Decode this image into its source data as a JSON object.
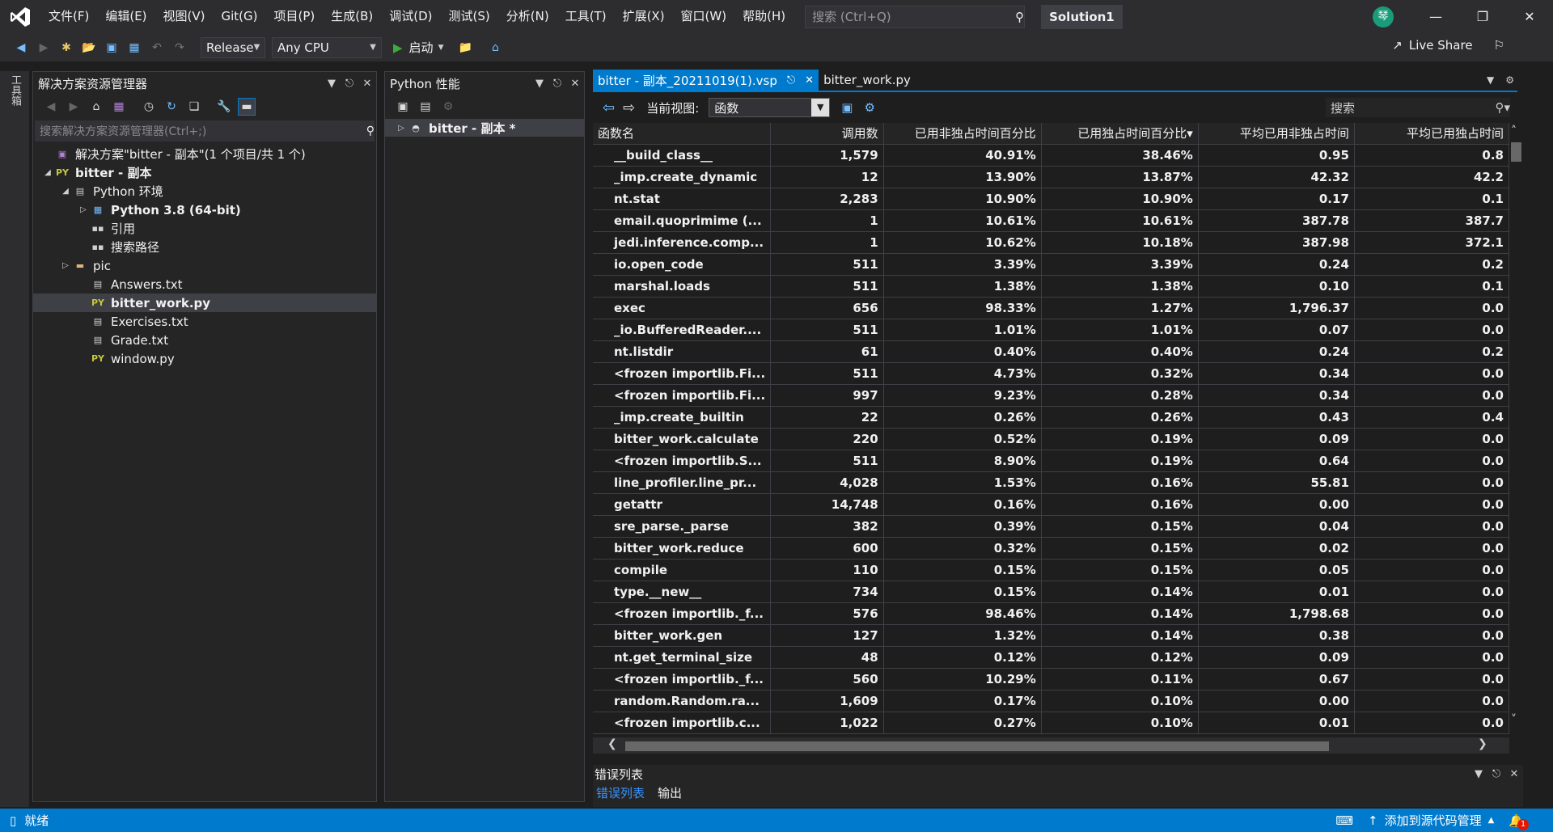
{
  "menubar": {
    "items": [
      "文件(F)",
      "编辑(E)",
      "视图(V)",
      "Git(G)",
      "项目(P)",
      "生成(B)",
      "调试(D)",
      "测试(S)",
      "分析(N)",
      "工具(T)",
      "扩展(X)",
      "窗口(W)",
      "帮助(H)"
    ],
    "search_placeholder": "搜索 (Ctrl+Q)",
    "solution_name": "Solution1",
    "avatar_initial": "琴"
  },
  "toolbar": {
    "config": "Release",
    "platform": "Any CPU",
    "start_label": "启动",
    "live_share": "Live Share"
  },
  "toolstrip": {
    "label": "工具箱"
  },
  "solution_explorer": {
    "title": "解决方案资源管理器",
    "search_placeholder": "搜索解决方案资源管理器(Ctrl+;)",
    "tree": [
      {
        "label": "解决方案\"bitter - 副本\"(1 个项目/共 1 个)",
        "bold": false
      },
      {
        "label": "bitter - 副本",
        "bold": true
      },
      {
        "label": "Python 环境",
        "bold": false
      },
      {
        "label": "Python 3.8 (64-bit)",
        "bold": true
      },
      {
        "label": "引用",
        "bold": false
      },
      {
        "label": "搜索路径",
        "bold": false
      },
      {
        "label": "pic",
        "bold": false
      },
      {
        "label": "Answers.txt",
        "bold": false
      },
      {
        "label": "bitter_work.py",
        "bold": true
      },
      {
        "label": "Exercises.txt",
        "bold": false
      },
      {
        "label": "Grade.txt",
        "bold": false
      },
      {
        "label": "window.py",
        "bold": false
      }
    ],
    "py_badge": "PY"
  },
  "python_performance": {
    "title": "Python 性能",
    "session": "bitter - 副本 *"
  },
  "doc_tabs": [
    {
      "label": "bitter - 副本_20211019(1).vsp",
      "active": true
    },
    {
      "label": "bitter_work.py",
      "active": false
    }
  ],
  "profiler": {
    "current_view_label": "当前视图:",
    "current_view_value": "函数",
    "search_placeholder": "搜索",
    "columns": [
      "函数名",
      "调用数",
      "已用非独占时间百分比",
      "已用独占时间百分比",
      "平均已用非独占时间",
      "平均已用独占时间"
    ],
    "sort_indicator": "▾",
    "rows": [
      [
        "__build_class__",
        "1,579",
        "40.91%",
        "38.46%",
        "0.95",
        "0.8"
      ],
      [
        "_imp.create_dynamic",
        "12",
        "13.90%",
        "13.87%",
        "42.32",
        "42.2"
      ],
      [
        "nt.stat",
        "2,283",
        "10.90%",
        "10.90%",
        "0.17",
        "0.1"
      ],
      [
        "email.quoprimime (...",
        "1",
        "10.61%",
        "10.61%",
        "387.78",
        "387.7"
      ],
      [
        "jedi.inference.comp...",
        "1",
        "10.62%",
        "10.18%",
        "387.98",
        "372.1"
      ],
      [
        "io.open_code",
        "511",
        "3.39%",
        "3.39%",
        "0.24",
        "0.2"
      ],
      [
        "marshal.loads",
        "511",
        "1.38%",
        "1.38%",
        "0.10",
        "0.1"
      ],
      [
        "exec",
        "656",
        "98.33%",
        "1.27%",
        "1,796.37",
        "0.0"
      ],
      [
        "_io.BufferedReader....",
        "511",
        "1.01%",
        "1.01%",
        "0.07",
        "0.0"
      ],
      [
        "nt.listdir",
        "61",
        "0.40%",
        "0.40%",
        "0.24",
        "0.2"
      ],
      [
        "<frozen importlib.Fi...",
        "511",
        "4.73%",
        "0.32%",
        "0.34",
        "0.0"
      ],
      [
        "<frozen importlib.Fi...",
        "997",
        "9.23%",
        "0.28%",
        "0.34",
        "0.0"
      ],
      [
        "_imp.create_builtin",
        "22",
        "0.26%",
        "0.26%",
        "0.43",
        "0.4"
      ],
      [
        "bitter_work.calculate",
        "220",
        "0.52%",
        "0.19%",
        "0.09",
        "0.0"
      ],
      [
        "<frozen importlib.S...",
        "511",
        "8.90%",
        "0.19%",
        "0.64",
        "0.0"
      ],
      [
        "line_profiler.line_pr...",
        "4,028",
        "1.53%",
        "0.16%",
        "55.81",
        "0.0"
      ],
      [
        "getattr",
        "14,748",
        "0.16%",
        "0.16%",
        "0.00",
        "0.0"
      ],
      [
        "sre_parse._parse",
        "382",
        "0.39%",
        "0.15%",
        "0.04",
        "0.0"
      ],
      [
        "bitter_work.reduce",
        "600",
        "0.32%",
        "0.15%",
        "0.02",
        "0.0"
      ],
      [
        "compile",
        "110",
        "0.15%",
        "0.15%",
        "0.05",
        "0.0"
      ],
      [
        "type.__new__",
        "734",
        "0.15%",
        "0.14%",
        "0.01",
        "0.0"
      ],
      [
        "<frozen importlib._f...",
        "576",
        "98.46%",
        "0.14%",
        "1,798.68",
        "0.0"
      ],
      [
        "bitter_work.gen",
        "127",
        "1.32%",
        "0.14%",
        "0.38",
        "0.0"
      ],
      [
        "nt.get_terminal_size",
        "48",
        "0.12%",
        "0.12%",
        "0.09",
        "0.0"
      ],
      [
        "<frozen importlib._f...",
        "560",
        "10.29%",
        "0.11%",
        "0.67",
        "0.0"
      ],
      [
        "random.Random.ra...",
        "1,609",
        "0.17%",
        "0.10%",
        "0.00",
        "0.0"
      ],
      [
        "<frozen importlib.c...",
        "1,022",
        "0.27%",
        "0.10%",
        "0.01",
        "0.0"
      ]
    ]
  },
  "error_panel": {
    "title": "错误列表",
    "tabs": [
      "错误列表",
      "输出"
    ]
  },
  "statusbar": {
    "status": "就绪",
    "source_control": "添加到源代码管理",
    "notification_count": "1"
  }
}
